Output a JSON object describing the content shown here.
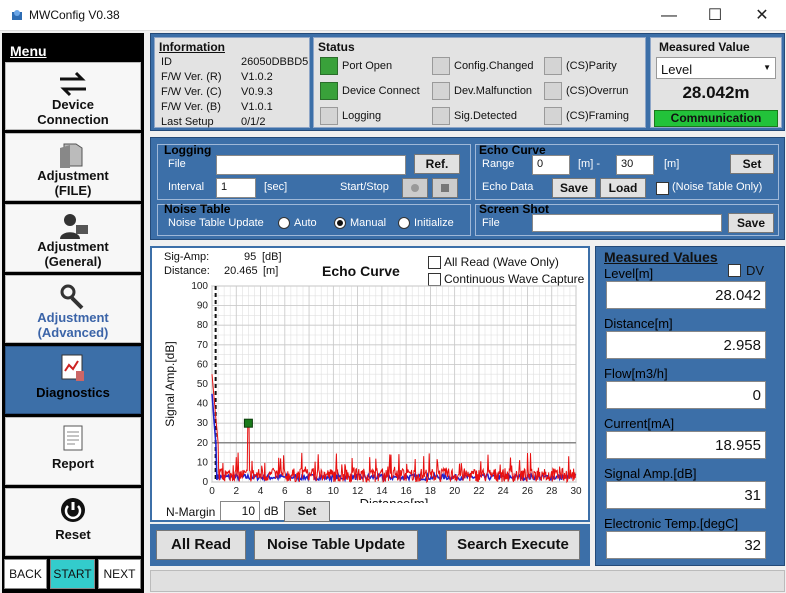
{
  "window": {
    "title": "MWConfig V0.38",
    "minimize": "—",
    "maximize": "☐",
    "close": "✕"
  },
  "menu": {
    "title": "Menu",
    "items": [
      {
        "label": "Device\nConnection",
        "icon": "arrows-exchange-icon"
      },
      {
        "label": "Adjustment\n(FILE)",
        "icon": "folder-icon"
      },
      {
        "label": "Adjustment\n(General)",
        "icon": "user-computer-icon"
      },
      {
        "label": "Adjustment\n(Advanced)",
        "icon": "wrench-gear-icon"
      },
      {
        "label": "Diagnostics",
        "icon": "diagnostics-icon"
      },
      {
        "label": "Report",
        "icon": "report-document-icon"
      },
      {
        "label": "Reset",
        "icon": "power-icon"
      }
    ],
    "nav": {
      "back": "BACK",
      "start": "START",
      "next": "NEXT"
    }
  },
  "information": {
    "title": "Information",
    "rows": [
      {
        "k": "ID",
        "v": "26050DBBD5"
      },
      {
        "k": "F/W Ver. (R)",
        "v": "V1.0.2"
      },
      {
        "k": "F/W Ver. (C)",
        "v": "V0.9.3"
      },
      {
        "k": "F/W Ver. (B)",
        "v": "V1.0.1"
      },
      {
        "k": "Last Setup",
        "v": "0/1/2"
      }
    ]
  },
  "status": {
    "title": "Status",
    "items": [
      {
        "label": "Port Open",
        "on": true
      },
      {
        "label": "Device Connect",
        "on": true
      },
      {
        "label": "Logging",
        "on": false
      },
      {
        "label": "Config.Changed",
        "on": false
      },
      {
        "label": "Dev.Malfunction",
        "on": false
      },
      {
        "label": "Sig.Detected",
        "on": false
      },
      {
        "label": "(CS)Parity",
        "on": false
      },
      {
        "label": "(CS)Overrun",
        "on": false
      },
      {
        "label": "(CS)Framing",
        "on": false
      }
    ]
  },
  "measured_value": {
    "title": "Measured Value",
    "select": "Level",
    "value": "28.042m",
    "comm": "Communication"
  },
  "logging": {
    "title": "Logging",
    "file_label": "File",
    "file_value": "",
    "ref": "Ref.",
    "interval_label": "Interval",
    "interval_value": "1",
    "interval_unit": "[sec]",
    "startstop": "Start/Stop"
  },
  "echo_curve_box": {
    "title": "Echo Curve",
    "range_label": "Range",
    "range_from": "0",
    "range_unit1": "[m] -",
    "range_to": "30",
    "range_unit2": "[m]",
    "set": "Set",
    "data_label": "Echo Data",
    "save": "Save",
    "load": "Load",
    "noise_table_only": "(Noise Table Only)"
  },
  "noise_table": {
    "title": "Noise Table",
    "update_label": "Noise Table Update",
    "options": [
      "Auto",
      "Manual",
      "Initialize"
    ],
    "selected": 1
  },
  "screen_shot": {
    "title": "Screen Shot",
    "file_label": "File",
    "file_value": "",
    "save": "Save"
  },
  "echo_chart": {
    "sig_amp_label": "Sig-Amp:",
    "sig_amp_value": "95",
    "sig_amp_unit": "[dB]",
    "distance_label": "Distance:",
    "distance_value": "20.465",
    "distance_unit": "[m]",
    "title": "Echo Curve",
    "all_read_wave_only": "All Read (Wave Only)",
    "continuous_capture": "Continuous Wave Capture",
    "nmargin_label": "N-Margin",
    "nmargin_value": "10",
    "nmargin_unit": "dB",
    "set": "Set"
  },
  "chart_data": {
    "type": "line",
    "title": "Echo Curve",
    "xlabel": "Distance[m]",
    "ylabel": "Signal Amp.[dB]",
    "xlim": [
      0,
      30
    ],
    "ylim": [
      0,
      100
    ],
    "x_ticks": [
      0,
      2,
      4,
      6,
      8,
      10,
      12,
      14,
      16,
      18,
      20,
      22,
      24,
      26,
      28,
      30
    ],
    "y_ticks": [
      0,
      10,
      20,
      30,
      40,
      50,
      60,
      70,
      80,
      90,
      100
    ],
    "grid": true,
    "threshold": 20,
    "marker": {
      "x": 3,
      "y": 30
    },
    "colors": {
      "echo": "#e81010",
      "noise": "#2222cc",
      "threshold": "#888888",
      "marker": "#1a7a1a"
    }
  },
  "bottom_buttons": {
    "all_read": "All Read",
    "noise_update": "Noise Table Update",
    "search_execute": "Search Execute"
  },
  "measured_values": {
    "title": "Measured Values",
    "dv": "DV",
    "items": [
      {
        "label": "Level[m]",
        "value": "28.042"
      },
      {
        "label": "Distance[m]",
        "value": "2.958"
      },
      {
        "label": "Flow[m3/h]",
        "value": "0"
      },
      {
        "label": "Current[mA]",
        "value": "18.955"
      },
      {
        "label": "Signal Amp.[dB]",
        "value": "31"
      },
      {
        "label": "Electronic Temp.[degC]",
        "value": "32"
      }
    ]
  }
}
